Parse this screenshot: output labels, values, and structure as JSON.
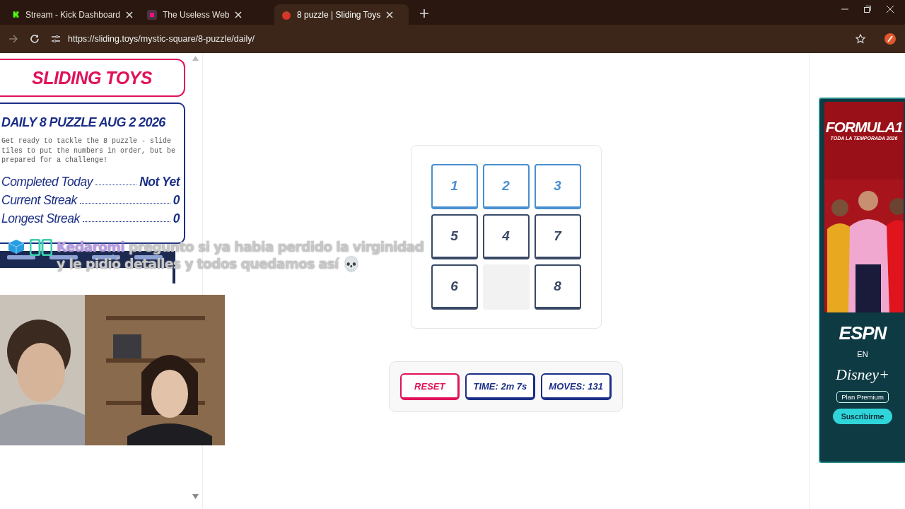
{
  "browser": {
    "tabs": [
      {
        "title": "Stream - Kick Dashboard",
        "selected": false,
        "kind": "kick"
      },
      {
        "title": "The Useless Web",
        "selected": false,
        "kind": "square"
      },
      {
        "title": "8 puzzle | Sliding Toys",
        "selected": true,
        "kind": "tomato"
      }
    ],
    "url": "https://sliding.toys/mystic-square/8-puzzle/daily/"
  },
  "sidebar": {
    "logo": "SLIDING TOYS",
    "title": "DAILY 8 PUZZLE AUG 2 2026",
    "intro": "Get ready to tackle the 8 puzzle - slide tiles to put the numbers in order, but be prepared for a challenge!",
    "stats": [
      {
        "label": "Completed Today",
        "value": "Not Yet"
      },
      {
        "label": "Current Streak",
        "value": "0"
      },
      {
        "label": "Longest Streak",
        "value": "0"
      }
    ]
  },
  "puzzle": {
    "tiles": [
      {
        "kind": "tile",
        "label": "1",
        "in_place": true
      },
      {
        "kind": "tile",
        "label": "2",
        "in_place": true
      },
      {
        "kind": "tile",
        "label": "3",
        "in_place": true
      },
      {
        "kind": "tile",
        "label": "5",
        "in_place": false
      },
      {
        "kind": "tile",
        "label": "4",
        "in_place": false
      },
      {
        "kind": "tile",
        "label": "7",
        "in_place": false
      },
      {
        "kind": "tile",
        "label": "6",
        "in_place": false
      },
      {
        "kind": "empty"
      },
      {
        "kind": "tile",
        "label": "8",
        "in_place": false
      }
    ],
    "buttons": [
      {
        "kind": "reset",
        "label": "RESET"
      },
      {
        "kind": "counter",
        "label": "TIME: 2m 7s"
      },
      {
        "kind": "counter",
        "label": "MOVES: 131"
      }
    ]
  },
  "ad": {
    "headline": "FORMULA1",
    "tagline": "TODA LA TEMPORADA 2026",
    "brand": "ESPN",
    "connector": "EN",
    "partner": "Disney+",
    "plan": "Plan Premium",
    "cta": "Suscribirme"
  },
  "stream_overlay": {
    "chat": {
      "user": "Kedaromi",
      "message": "pregunto si ya habia perdido la virginidad y le pidió detalles y todos quedamos así 💀"
    }
  }
}
